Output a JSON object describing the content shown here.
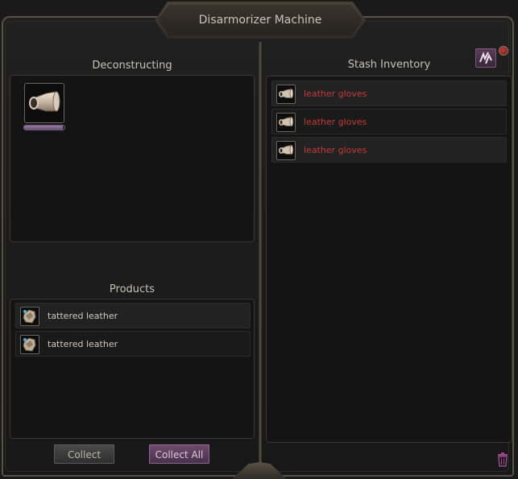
{
  "window": {
    "title": "Disarmorizer Machine"
  },
  "left": {
    "deconstructing_title": "Deconstructing",
    "slot_icon": "tube-item-icon",
    "progress_fraction": 0.95,
    "products_title": "Products",
    "products": [
      {
        "label": "tattered leather",
        "icon": "leather-scrap-icon"
      },
      {
        "label": "tattered leather",
        "icon": "leather-scrap-icon"
      }
    ],
    "collect_label": "Collect",
    "collect_all_label": "Collect All"
  },
  "right": {
    "stash_title": "Stash Inventory",
    "items": [
      {
        "label": "leather gloves",
        "icon": "tube-item-icon"
      },
      {
        "label": "leather gloves",
        "icon": "tube-item-icon"
      },
      {
        "label": "leather gloves",
        "icon": "tube-item-icon"
      }
    ],
    "sort_icon": "sort-icon",
    "close_icon": "close-dot-icon",
    "trash_icon": "trash-icon"
  },
  "colors": {
    "item_text_red": "#c23a3a",
    "product_text": "#cfc9bf",
    "accent_purple": "#6e4a6e"
  }
}
